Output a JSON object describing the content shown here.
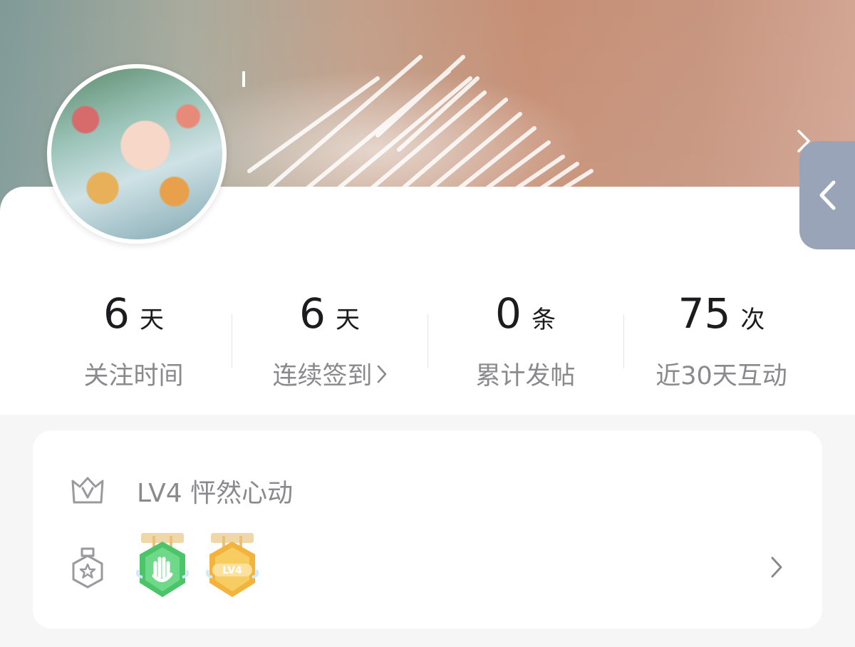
{
  "profile": {
    "avatar_icon": "avatar-photo"
  },
  "stats": [
    {
      "value": "6",
      "unit": "天",
      "label": "关注时间",
      "has_arrow": false
    },
    {
      "value": "6",
      "unit": "天",
      "label": "连续签到",
      "has_arrow": true
    },
    {
      "value": "0",
      "unit": "条",
      "label": "累计发帖",
      "has_arrow": false
    },
    {
      "value": "75",
      "unit": "次",
      "label": "近30天互动",
      "has_arrow": false
    }
  ],
  "level": {
    "icon": "crown-v-icon",
    "text": "LV4 怦然心动"
  },
  "badges": {
    "icon": "medal-star-icon",
    "items": [
      {
        "name": "hand-wave-medal",
        "color": "#4cc46a"
      },
      {
        "name": "lv4-medal",
        "color": "#f2b43c",
        "label": "LV4"
      }
    ]
  },
  "colors": {
    "side_tab": "#9aa4b8",
    "label_gray": "#8a8a8e"
  }
}
